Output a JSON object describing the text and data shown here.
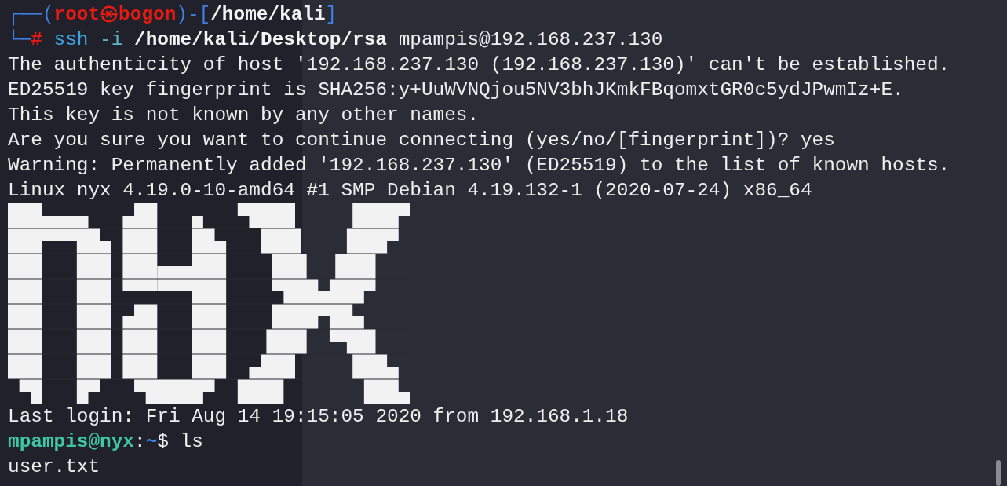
{
  "session_prompt": {
    "frame_top": "┌──(",
    "user_host": "root㉿bogon",
    "frame_mid": ")-[",
    "cwd": "/home/kali",
    "frame_end": "]",
    "frame_bottom": "└─",
    "symbol": "#",
    "program": "ssh",
    "option": "-i",
    "key_path": "/home/kali/Desktop/rsa",
    "target": "mpampis@192.168.237.130"
  },
  "output_lines": [
    "The authenticity of host '192.168.237.130 (192.168.237.130)' can't be established.",
    "ED25519 key fingerprint is SHA256:y+UuWVNQjou5NV3bhJKmkFBqomxtGR0c5ydJPwmIz+E.",
    "This key is not known by any other names.",
    "Are you sure you want to continue connecting (yes/no/[fingerprint])? yes",
    "Warning: Permanently added '192.168.237.130' (ED25519) to the list of known hosts.",
    "Linux nyx 4.19.0-10-amd64 #1 SMP Debian 4.19.132-1 (2020-07-24) x86_64"
  ],
  "last_login": "Last login: Fri Aug 14 19:15:05 2020 from 192.168.1.18",
  "shell_prompt": {
    "user_host": "mpampis@nyx",
    "separator": ":",
    "path": "~",
    "symbol": "$",
    "command": "ls"
  },
  "listing": [
    "user.txt"
  ]
}
